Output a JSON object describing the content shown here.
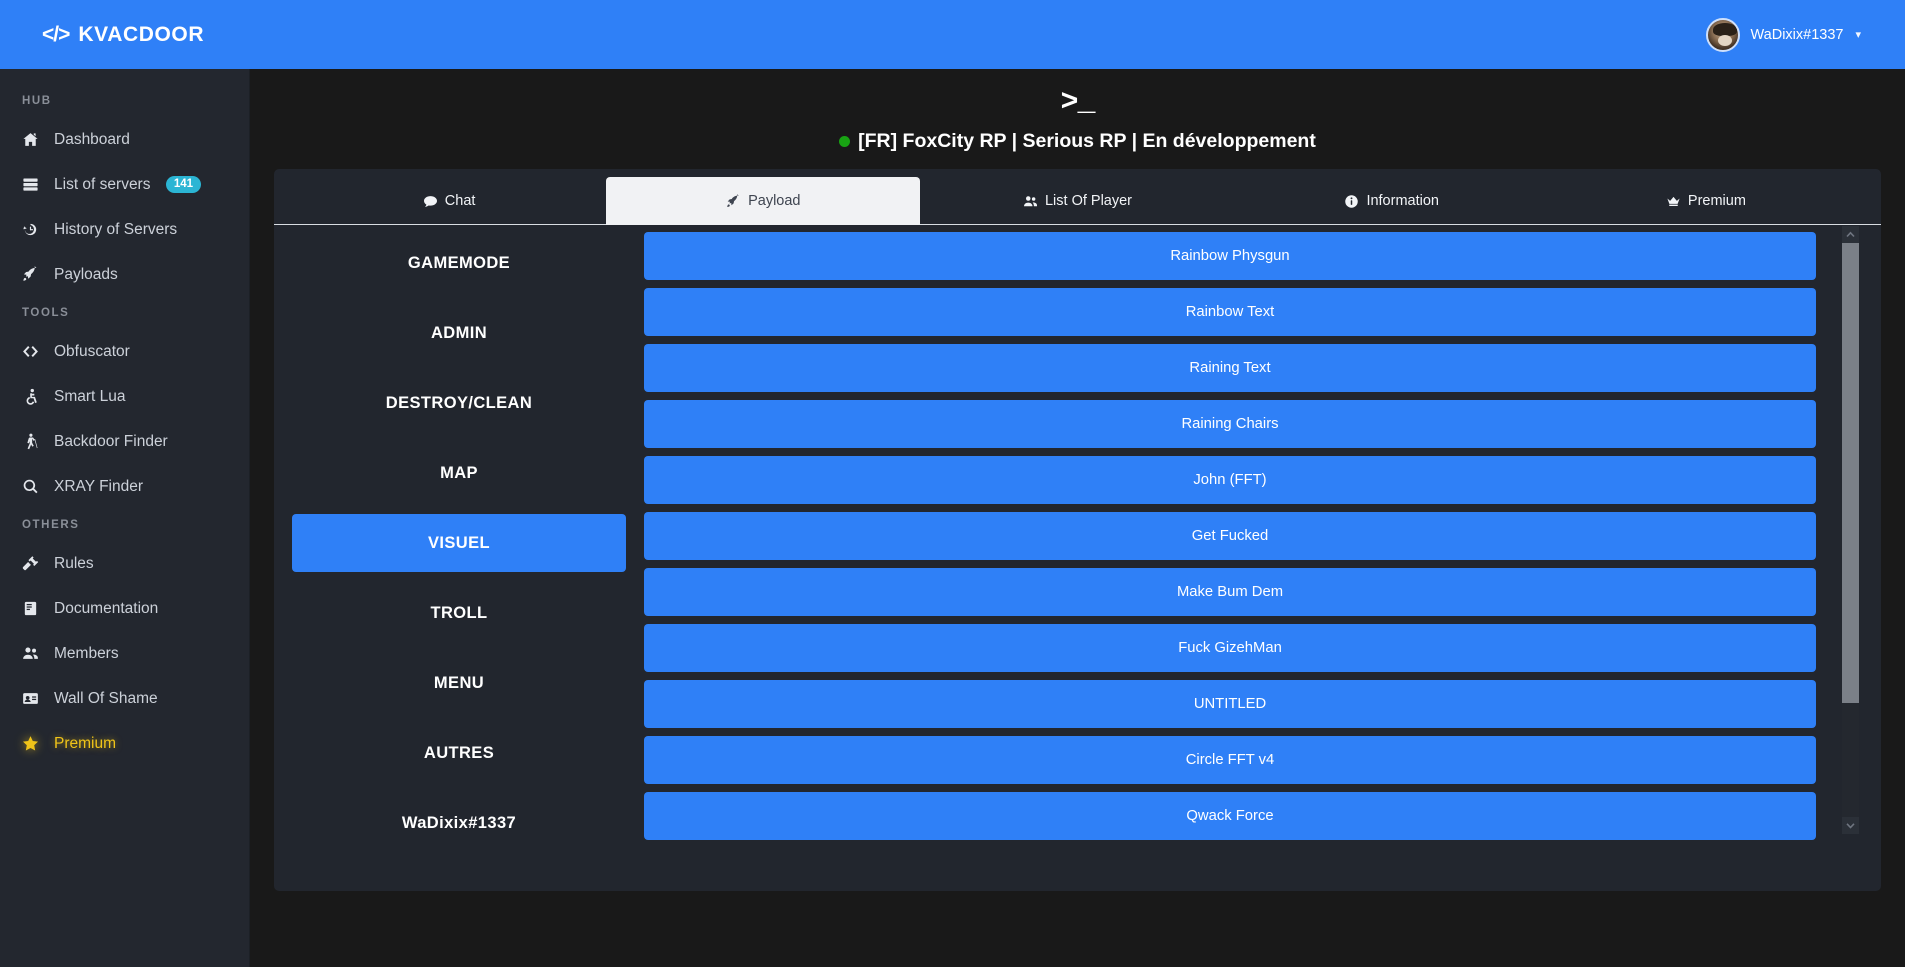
{
  "brand": {
    "code_icon": "</>",
    "name": "KVACDOOR"
  },
  "topbar": {
    "user_name": "WaDixix#1337",
    "chevron": "▾",
    "avatar_icon": "user-avatar"
  },
  "sidebar": {
    "sections": [
      {
        "heading": "HUB",
        "items": [
          {
            "label": "Dashboard",
            "icon": "home-icon",
            "badge": null,
            "highlight": false
          },
          {
            "label": "List of servers",
            "icon": "server-icon",
            "badge": "141",
            "highlight": false
          },
          {
            "label": "History of Servers",
            "icon": "history-icon",
            "badge": null,
            "highlight": false
          },
          {
            "label": "Payloads",
            "icon": "rocket-icon",
            "badge": null,
            "highlight": false
          }
        ]
      },
      {
        "heading": "TOOLS",
        "items": [
          {
            "label": "Obfuscator",
            "icon": "code-icon",
            "badge": null,
            "highlight": false
          },
          {
            "label": "Smart Lua",
            "icon": "wheelchair-icon",
            "badge": null,
            "highlight": false
          },
          {
            "label": "Backdoor Finder",
            "icon": "blind-person-icon",
            "badge": null,
            "highlight": false
          },
          {
            "label": "XRAY Finder",
            "icon": "search-icon",
            "badge": null,
            "highlight": false
          }
        ]
      },
      {
        "heading": "OTHERS",
        "items": [
          {
            "label": "Rules",
            "icon": "gavel-icon",
            "badge": null,
            "highlight": false
          },
          {
            "label": "Documentation",
            "icon": "book-icon",
            "badge": null,
            "highlight": false
          },
          {
            "label": "Members",
            "icon": "users-icon",
            "badge": null,
            "highlight": false
          },
          {
            "label": "Wall Of Shame",
            "icon": "id-card-icon",
            "badge": null,
            "highlight": false
          },
          {
            "label": "Premium",
            "icon": "star-icon",
            "badge": null,
            "highlight": true
          }
        ]
      }
    ]
  },
  "server": {
    "terminal_icon": ">_",
    "status_icon": "online-dot",
    "status_color": "#18a313",
    "title": "[FR] FoxCity RP | Serious RP | En développement"
  },
  "tabs": [
    {
      "label": "Chat",
      "icon": "chat-bubble-icon",
      "active": false
    },
    {
      "label": "Payload",
      "icon": "rocket-icon",
      "active": true
    },
    {
      "label": "List Of Player",
      "icon": "users-icon",
      "active": false
    },
    {
      "label": "Information",
      "icon": "info-circle-icon",
      "active": false
    },
    {
      "label": "Premium",
      "icon": "crown-icon",
      "active": false
    }
  ],
  "categories": [
    {
      "label": "GAMEMODE",
      "active": false
    },
    {
      "label": "ADMIN",
      "active": false
    },
    {
      "label": "DESTROY/CLEAN",
      "active": false
    },
    {
      "label": "MAP",
      "active": false
    },
    {
      "label": "VISUEL",
      "active": true
    },
    {
      "label": "TROLL",
      "active": false
    },
    {
      "label": "MENU",
      "active": false
    },
    {
      "label": "AUTRES",
      "active": false
    },
    {
      "label": "WaDixix#1337",
      "active": false
    }
  ],
  "payloads": [
    {
      "label": "Rainbow Physgun"
    },
    {
      "label": "Rainbow Text"
    },
    {
      "label": "Raining Text"
    },
    {
      "label": "Raining Chairs"
    },
    {
      "label": "John (FFT)"
    },
    {
      "label": "Get Fucked"
    },
    {
      "label": "Make Bum Dem"
    },
    {
      "label": "Fuck GizehMan"
    },
    {
      "label": "UNTITLED"
    },
    {
      "label": "Circle FFT v4"
    },
    {
      "label": "Qwack Force"
    }
  ],
  "scrollbar": {
    "up_icon": "chevron-up-icon",
    "down_icon": "chevron-down-icon"
  },
  "colors": {
    "accent_blue": "#2f80f7",
    "badge_cyan": "#2bb5d4",
    "premium_gold": "#f0c419",
    "online_green": "#18a313",
    "sidebar_bg": "#23272f",
    "card_bg": "#22262e",
    "page_bg": "#191919"
  }
}
